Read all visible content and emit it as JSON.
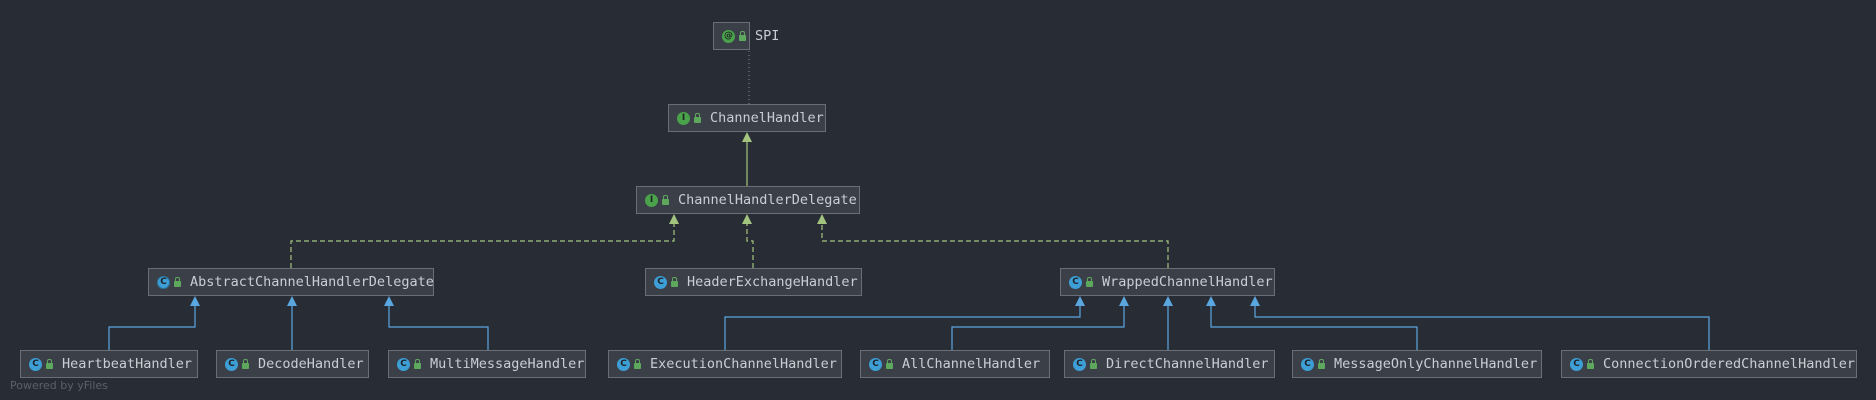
{
  "diagram": {
    "nodes": [
      {
        "id": "spi",
        "label": "SPI",
        "kind": "annotation",
        "kind_glyph": "@"
      },
      {
        "id": "channel-handler",
        "label": "ChannelHandler",
        "kind": "interface",
        "kind_glyph": "I"
      },
      {
        "id": "channel-handler-delegate",
        "label": "ChannelHandlerDelegate",
        "kind": "interface",
        "kind_glyph": "I"
      },
      {
        "id": "abstract-channel-handler-delegate",
        "label": "AbstractChannelHandlerDelegate",
        "kind": "abstract-class",
        "kind_glyph": "C"
      },
      {
        "id": "header-exchange-handler",
        "label": "HeaderExchangeHandler",
        "kind": "class",
        "kind_glyph": "C"
      },
      {
        "id": "wrapped-channel-handler",
        "label": "WrappedChannelHandler",
        "kind": "class",
        "kind_glyph": "C"
      },
      {
        "id": "heartbeat-handler",
        "label": "HeartbeatHandler",
        "kind": "class",
        "kind_glyph": "C"
      },
      {
        "id": "decode-handler",
        "label": "DecodeHandler",
        "kind": "class",
        "kind_glyph": "C"
      },
      {
        "id": "multi-message-handler",
        "label": "MultiMessageHandler",
        "kind": "class",
        "kind_glyph": "C"
      },
      {
        "id": "execution-channel-handler",
        "label": "ExecutionChannelHandler",
        "kind": "class",
        "kind_glyph": "C"
      },
      {
        "id": "all-channel-handler",
        "label": "AllChannelHandler",
        "kind": "class",
        "kind_glyph": "C"
      },
      {
        "id": "direct-channel-handler",
        "label": "DirectChannelHandler",
        "kind": "class",
        "kind_glyph": "C"
      },
      {
        "id": "message-only-channel-handler",
        "label": "MessageOnlyChannelHandler",
        "kind": "class",
        "kind_glyph": "C"
      },
      {
        "id": "connection-ordered-channel-handler",
        "label": "ConnectionOrderedChannelHandler",
        "kind": "class",
        "kind_glyph": "C"
      }
    ],
    "edges": [
      {
        "from": "channel-handler",
        "to": "spi",
        "type": "annotated-with"
      },
      {
        "from": "channel-handler-delegate",
        "to": "channel-handler",
        "type": "extends"
      },
      {
        "from": "abstract-channel-handler-delegate",
        "to": "channel-handler-delegate",
        "type": "implements"
      },
      {
        "from": "header-exchange-handler",
        "to": "channel-handler-delegate",
        "type": "implements"
      },
      {
        "from": "wrapped-channel-handler",
        "to": "channel-handler-delegate",
        "type": "implements"
      },
      {
        "from": "heartbeat-handler",
        "to": "abstract-channel-handler-delegate",
        "type": "extends"
      },
      {
        "from": "decode-handler",
        "to": "abstract-channel-handler-delegate",
        "type": "extends"
      },
      {
        "from": "multi-message-handler",
        "to": "abstract-channel-handler-delegate",
        "type": "extends"
      },
      {
        "from": "execution-channel-handler",
        "to": "wrapped-channel-handler",
        "type": "extends"
      },
      {
        "from": "all-channel-handler",
        "to": "wrapped-channel-handler",
        "type": "extends"
      },
      {
        "from": "direct-channel-handler",
        "to": "wrapped-channel-handler",
        "type": "extends"
      },
      {
        "from": "message-only-channel-handler",
        "to": "wrapped-channel-handler",
        "type": "extends"
      },
      {
        "from": "connection-ordered-channel-handler",
        "to": "wrapped-channel-handler",
        "type": "extends"
      }
    ],
    "colors": {
      "extends_interface": "#a3c47e",
      "extends_class": "#5aa7e0",
      "implements": "#a3c47e",
      "annotated_with": "#7c8088"
    }
  },
  "watermark": "Powered by yFiles"
}
